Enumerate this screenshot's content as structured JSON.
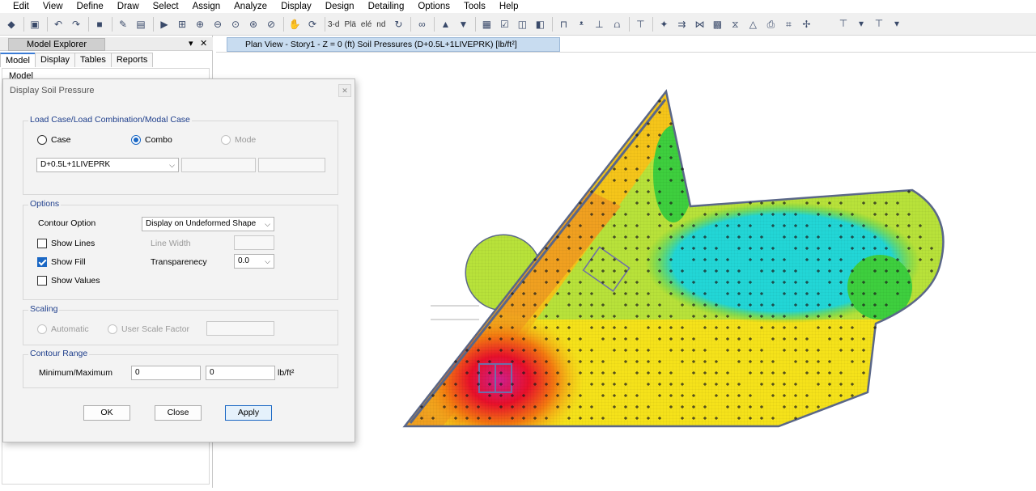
{
  "menu": [
    "Edit",
    "View",
    "Define",
    "Draw",
    "Select",
    "Assign",
    "Analyze",
    "Display",
    "Design",
    "Detailing",
    "Options",
    "Tools",
    "Help"
  ],
  "toolbar": {
    "three_d_label": "3-d",
    "plan_label": "Plä",
    "elev_label": "elé",
    "nd_label": "nd"
  },
  "explorer": {
    "title": "Model Explorer",
    "pin": "▾",
    "close": "✕",
    "tabs": [
      "Model",
      "Display",
      "Tables",
      "Reports"
    ],
    "tree_root": "Model"
  },
  "dialog": {
    "title": "Display Soil Pressure",
    "close_glyph": "✕",
    "load_group": {
      "label": "Load Case/Load Combination/Modal Case",
      "options": [
        "Case",
        "Combo",
        "Mode"
      ],
      "selected": "Combo",
      "combo_value": "D+0.5L+1LIVEPRK"
    },
    "options_group": {
      "label": "Options",
      "contour_option_label": "Contour Option",
      "contour_option_value": "Display on Undeformed Shape",
      "show_lines_label": "Show Lines",
      "show_lines_checked": false,
      "line_width_label": "Line Width",
      "show_fill_label": "Show Fill",
      "show_fill_checked": true,
      "transparency_label": "Transparenecy",
      "transparency_value": "0.0",
      "show_values_label": "Show Values",
      "show_values_checked": false
    },
    "scaling_group": {
      "label": "Scaling",
      "automatic_label": "Automatic",
      "user_scale_label": "User Scale Factor"
    },
    "contour_range_group": {
      "label": "Contour Range",
      "minmax_label": "Minimum/Maximum",
      "min_value": "0",
      "max_value": "0",
      "unit": "lb/ft²"
    },
    "buttons": {
      "ok": "OK",
      "close": "Close",
      "apply": "Apply"
    }
  },
  "plan_view": {
    "tab_title": "Plan View - Story1 - Z = 0 (ft)   Soil Pressures   (D+0.5L+1LIVEPRK)  [lb/ft²]"
  },
  "colors": {
    "accent": "#1a67c4",
    "contour_high": "#e8102a",
    "contour_mid": "#f5e21a",
    "contour_low": "#22d6d6",
    "contour_green": "#3ecf3e",
    "contour_magenta": "#d0208e"
  }
}
